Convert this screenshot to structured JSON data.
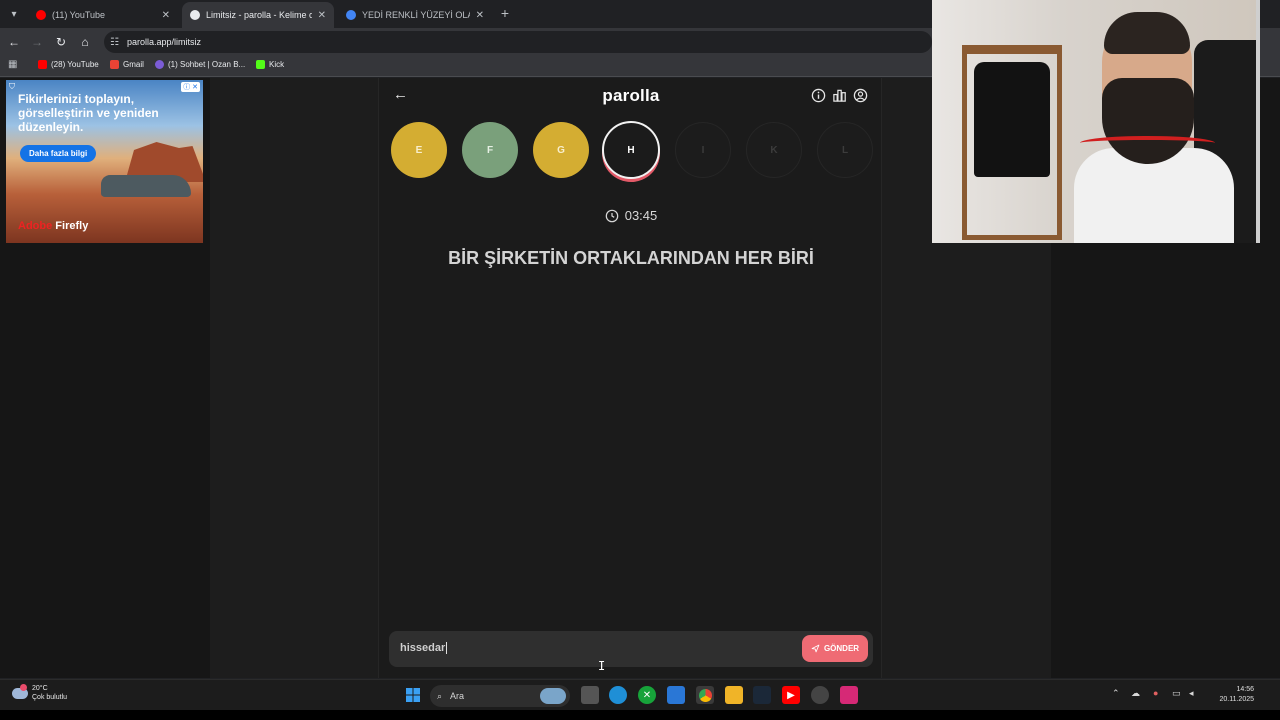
{
  "browser": {
    "tabs": [
      {
        "title": "(11) YouTube",
        "favicon_color": "#ff0000",
        "active": false
      },
      {
        "title": "Limitsiz - parolla - Kelime oyunu",
        "favicon_color": "#e8eaed",
        "active": true
      },
      {
        "title": "YEDİ RENKLİ YÜZEYİ OLAN ZEK",
        "favicon_color": "#4285f4",
        "active": false
      }
    ],
    "url": "parolla.app/limitsiz",
    "bookmarks": [
      {
        "label": "(28) YouTube",
        "color": "#ff0000"
      },
      {
        "label": "Gmail",
        "color": "#ea4335"
      },
      {
        "label": "(1) Sohbet | Ozan B...",
        "color": "#7b5cd6"
      },
      {
        "label": "Kick",
        "color": "#53fc18"
      }
    ]
  },
  "ad": {
    "headline": "Fikirlerinizi toplayın, görselleştirin ve yeniden düzenleyin.",
    "cta": "Daha fazla bilgi",
    "brand_prefix": "Adobe",
    "brand_name": "Firefly"
  },
  "app": {
    "logo": "parolla",
    "letters": [
      {
        "letter": "E",
        "state": "yellow"
      },
      {
        "letter": "F",
        "state": "green"
      },
      {
        "letter": "G",
        "state": "yellow"
      },
      {
        "letter": "H",
        "state": "current"
      },
      {
        "letter": "I",
        "state": "empty"
      },
      {
        "letter": "K",
        "state": "empty"
      },
      {
        "letter": "L",
        "state": "empty"
      }
    ],
    "timer": "03:45",
    "question": "BİR ŞİRKETİN ORTAKLARINDAN HER BİRİ",
    "answer_value": "hissedar",
    "send_label": "GÖNDER"
  },
  "taskbar": {
    "weather_temp": "20°C",
    "weather_desc": "Çok bulutlu",
    "search_label": "Ara",
    "time": "14:56",
    "date": "20.11.2025"
  },
  "colors": {
    "accent": "#ef6b74",
    "correct": "#7aa07b",
    "passed": "#d4ad32"
  }
}
